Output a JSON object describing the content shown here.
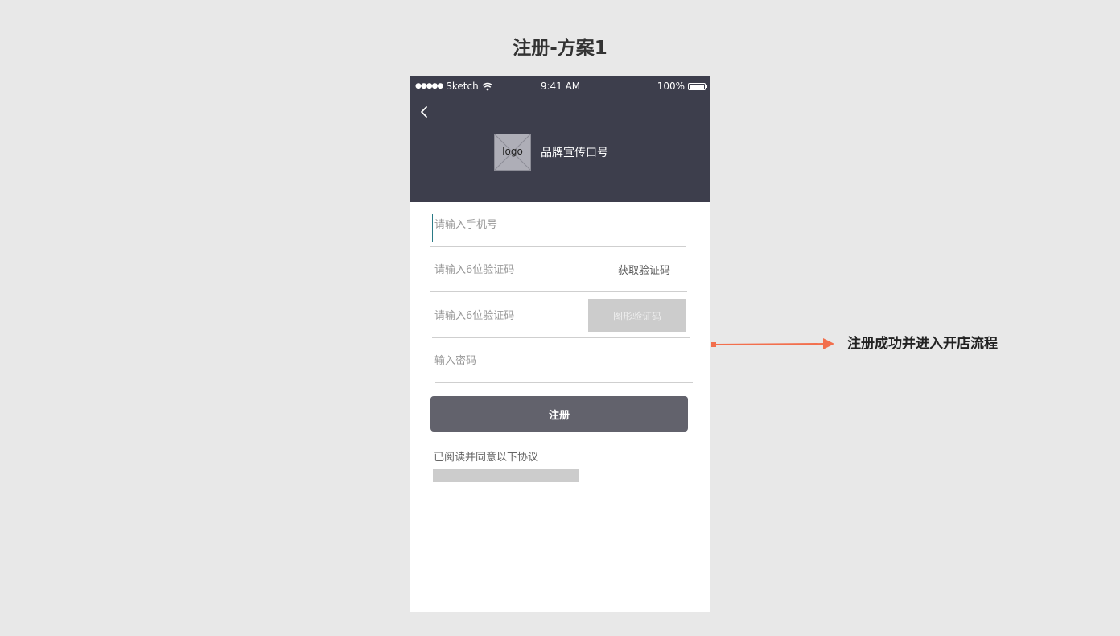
{
  "page": {
    "title": "注册-方案1",
    "flow_note": "注册成功并进入开店流程"
  },
  "status_bar": {
    "signal": "●●●●●",
    "carrier": "Sketch",
    "time": "9:41 AM",
    "battery": "100%"
  },
  "header": {
    "logo_label": "logo",
    "slogan": "品牌宣传口号"
  },
  "form": {
    "phone_placeholder": "请输入手机号",
    "sms_code_placeholder": "请输入6位验证码",
    "get_code_label": "获取验证码",
    "captcha_placeholder": "请输入6位验证码",
    "captcha_label": "图形验证码",
    "password_placeholder": "输入密码",
    "register_label": "注册",
    "agreement_text": "已阅读并同意以下协议"
  },
  "colors": {
    "header_bg": "#3d3e4c",
    "button_bg": "#62626c",
    "arrow": "#f26f4d",
    "cursor": "#2a7a86"
  }
}
